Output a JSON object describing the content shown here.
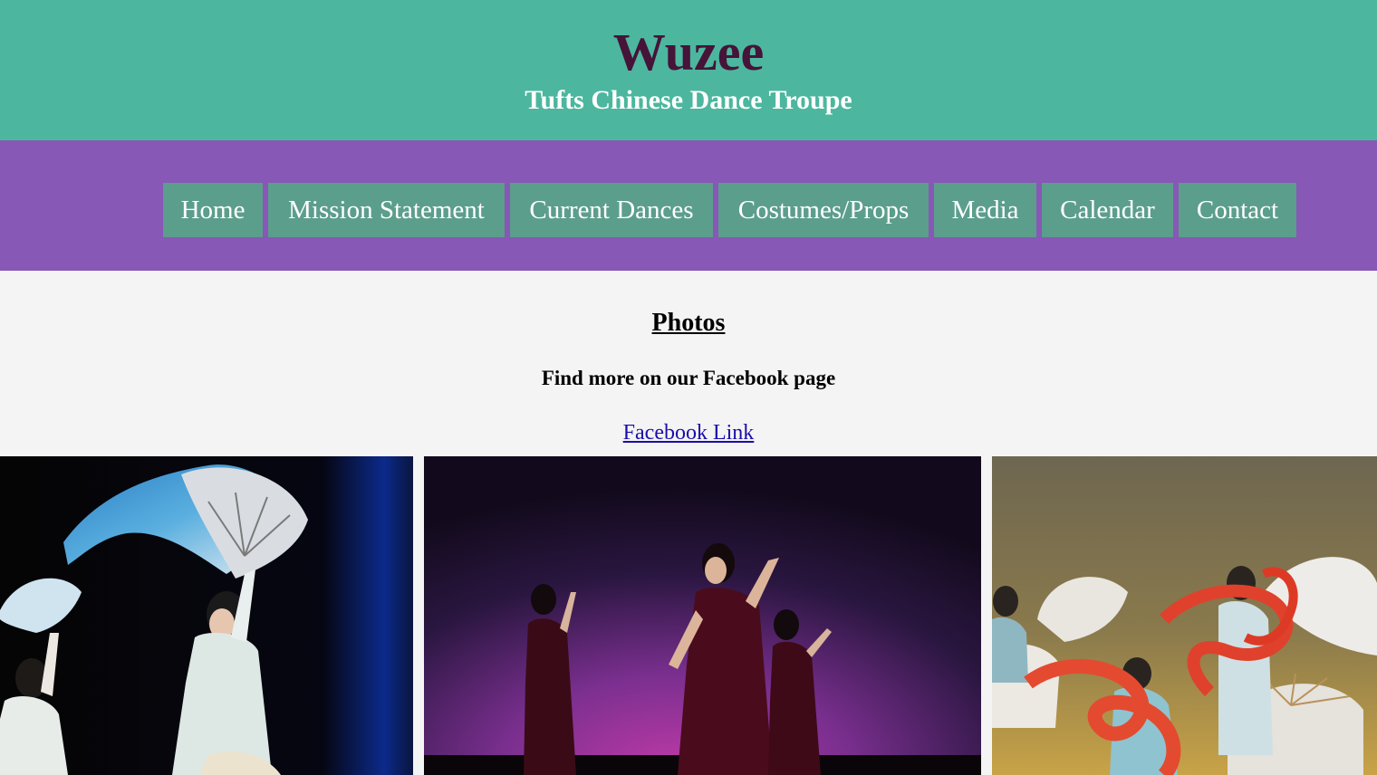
{
  "header": {
    "title": "Wuzee",
    "subtitle": "Tufts Chinese Dance Troupe"
  },
  "nav": {
    "items": [
      {
        "label": "Home"
      },
      {
        "label": "Mission Statement"
      },
      {
        "label": "Current Dances"
      },
      {
        "label": "Costumes/Props"
      },
      {
        "label": "Media"
      },
      {
        "label": "Calendar"
      },
      {
        "label": "Contact"
      }
    ]
  },
  "main": {
    "section_title": "Photos",
    "facebook_text": "Find more on our Facebook page",
    "facebook_link": "Facebook Link"
  },
  "colors": {
    "header_bg": "#4db69e",
    "title": "#461339",
    "nav_bg": "#8758b5",
    "nav_item_bg": "#5c9e8c",
    "page_bg": "#f4f4f4",
    "link": "#1a0dab"
  }
}
